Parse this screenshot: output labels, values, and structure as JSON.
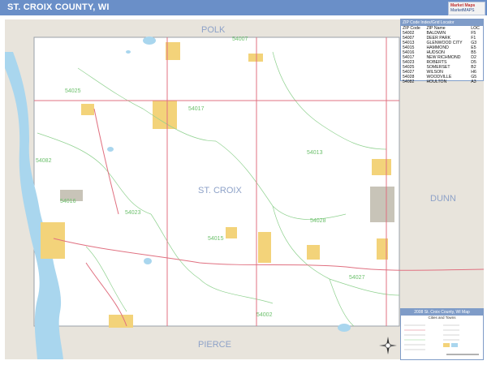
{
  "header": {
    "title": "ST. CROIX COUNTY, WI",
    "logo_line1": "Market Maps",
    "logo_line2": "MarketMAPS"
  },
  "map": {
    "county_labels": [
      "POLK",
      "ST. CROIX",
      "DUNN",
      "PIERCE"
    ],
    "zip_labels": [
      "54007",
      "54025",
      "54017",
      "54013",
      "54082",
      "54016",
      "54023",
      "54028",
      "54015",
      "54027",
      "54002"
    ],
    "colors": {
      "county_fill": "#ffffff",
      "neighbor_fill": "#e8e4dc",
      "town_fill": "#f3d37a",
      "water": "#a9d6ee",
      "zip_lines": "#8fd18f",
      "roads": "#e07080",
      "header": "#6a8fc8"
    }
  },
  "zip_legend": {
    "title": "ZIP Code Index/Grid Locator",
    "columns": [
      "ZIP Code",
      "ZIP Name",
      "LOC"
    ],
    "rows": [
      [
        "54002",
        "BALDWIN",
        "F5"
      ],
      [
        "54007",
        "DEER PARK",
        "F1"
      ],
      [
        "54013",
        "GLENWOOD CITY",
        "G3"
      ],
      [
        "54015",
        "HAMMOND",
        "E5"
      ],
      [
        "54016",
        "HUDSON",
        "B5"
      ],
      [
        "54017",
        "NEW RICHMOND",
        "D2"
      ],
      [
        "54023",
        "ROBERTS",
        "D5"
      ],
      [
        "54025",
        "SOMERSET",
        "B2"
      ],
      [
        "54027",
        "WILSON",
        "H6"
      ],
      [
        "54028",
        "WOODVILLE",
        "G5"
      ],
      [
        "54082",
        "HOULTON",
        "A3"
      ]
    ]
  },
  "map_legend": {
    "title": "2008 St. Croix County, WI Map",
    "subtitle": "Cities and Towns"
  },
  "icons": {
    "compass": "compass-rose-icon",
    "logo": "logo-icon"
  }
}
